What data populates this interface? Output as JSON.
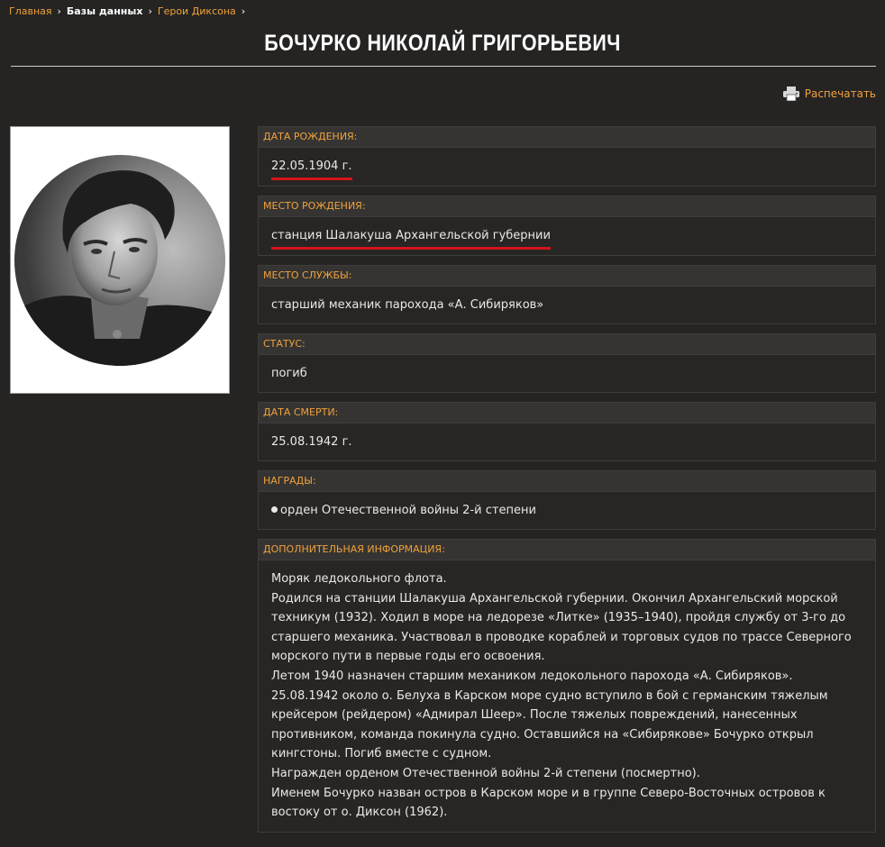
{
  "breadcrumb": {
    "home": "Главная",
    "databases": "Базы данных",
    "section": "Герои Диксона"
  },
  "title": "БОЧУРКО НИКОЛАЙ ГРИГОРЬЕВИЧ",
  "print_label": "Распечатать",
  "fields": {
    "birth_date": {
      "label": "ДАТА РОЖДЕНИЯ:",
      "value": "22.05.1904 г."
    },
    "birth_place": {
      "label": "МЕСТО РОЖДЕНИЯ:",
      "value": "станция Шалакуша Архангельской губернии"
    },
    "service_place": {
      "label": "МЕСТО СЛУЖБЫ:",
      "value": "старший механик парохода «А. Сибиряков»"
    },
    "status": {
      "label": "СТАТУС:",
      "value": "погиб"
    },
    "death_date": {
      "label": "ДАТА СМЕРТИ:",
      "value": "25.08.1942 г."
    },
    "awards": {
      "label": "НАГРАДЫ:",
      "items": [
        "орден Отечественной войны 2-й степени"
      ]
    },
    "additional": {
      "label": "ДОПОЛНИТЕЛЬНАЯ ИНФОРМАЦИЯ:",
      "lines": [
        "Моряк ледокольного флота.",
        "Родился на станции Шалакуша Архангельской губернии. Окончил Архангельский морской техникум (1932). Ходил в море на ледорезе «Литке» (1935–1940), пройдя службу от 3-го до старшего механика. Участвовал в проводке кораблей и торговых судов по трассе Северного морского пути в первые годы его освоения.",
        "Летом 1940 назначен старшим механиком ледокольного парохода «А. Сибиряков».",
        "25.08.1942 около о. Белуха в Карском море судно вступило в бой с германским тяжелым крейсером (рейдером) «Адмирал Шеер». После тяжелых повреждений, нанесенных противником, команда покинула судно. Оставшийся на «Сибирякове» Бочурко открыл кингстоны. Погиб вместе с судном.",
        "Награжден орденом Отечественной войны 2-й степени (посмертно).",
        "Именем Бочурко назван остров в Карском море и в группе Северо-Восточных островов к востоку от о. Диксон (1962)."
      ]
    }
  },
  "colors": {
    "background": "#252423",
    "accent": "#f0a13a",
    "highlight_underline": "#d4141b"
  },
  "icons": {
    "breadcrumb_separator": "chevron-right-icon",
    "print": "printer-icon",
    "award_bullet": "bullet-icon"
  }
}
